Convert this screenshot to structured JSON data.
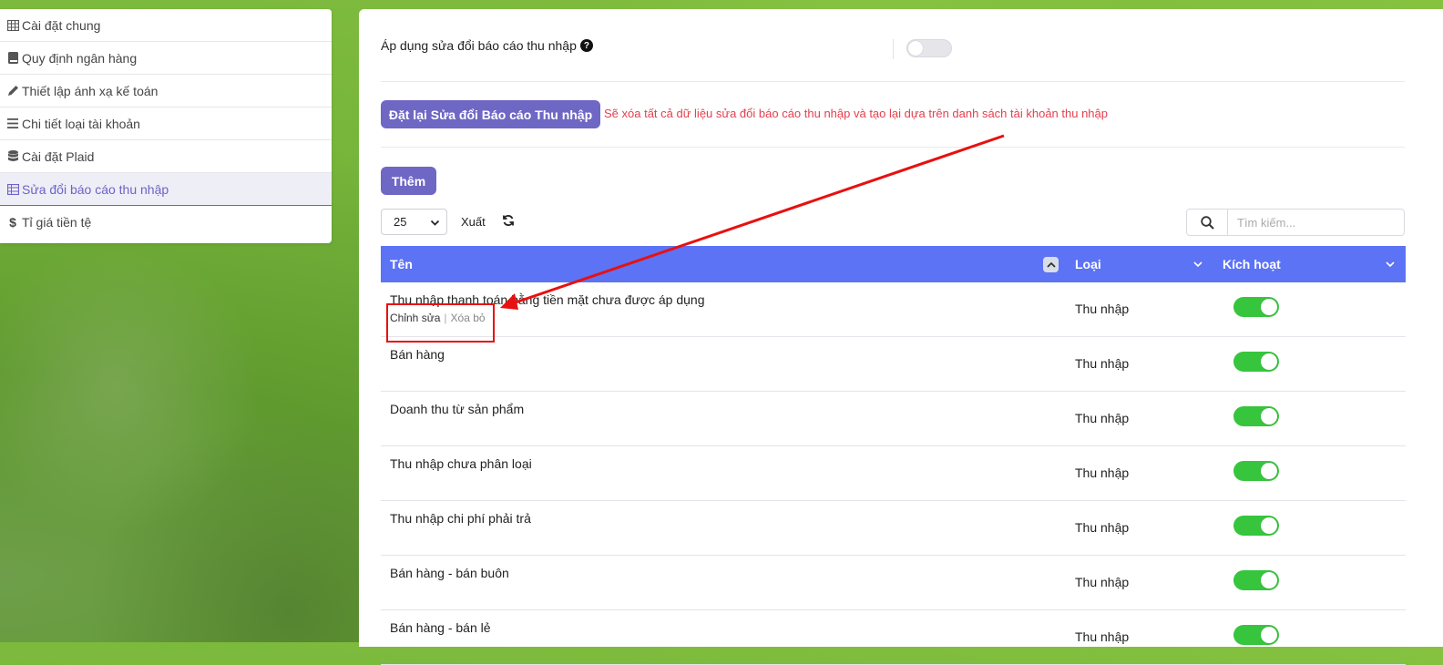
{
  "sidebar": {
    "items": [
      {
        "label": "Cài đặt chung",
        "icon": "table-icon",
        "active": false
      },
      {
        "label": "Quy định ngân hàng",
        "icon": "book-icon",
        "active": false
      },
      {
        "label": "Thiết lập ánh xạ kế toán",
        "icon": "pencil-icon",
        "active": false
      },
      {
        "label": "Chi tiết loại tài khoản",
        "icon": "list-icon",
        "active": false
      },
      {
        "label": "Cài đặt Plaid",
        "icon": "database-icon",
        "active": false
      },
      {
        "label": "Sửa đổi báo cáo thu nhập",
        "icon": "table-icon",
        "active": true
      },
      {
        "label": "Tỉ giá tiền tệ",
        "icon": "dollar-icon",
        "active": false
      }
    ]
  },
  "settings": {
    "apply_label": "Áp dụng sửa đổi báo cáo thu nhập",
    "apply_help_icon": "question-circle-icon",
    "apply_enabled": false
  },
  "reset": {
    "button_label": "Đặt lại Sửa đổi Báo cáo Thu nhập",
    "warning": "Sẽ xóa tất cả dữ liệu sửa đổi báo cáo thu nhập và tạo lại dựa trên danh sách tài khoản thu nhập"
  },
  "toolbar": {
    "add_label": "Thêm",
    "page_size": "25",
    "export_label": "Xuất",
    "search_placeholder": "Tìm kiếm..."
  },
  "table": {
    "headers": {
      "name": "Tên",
      "type": "Loại",
      "active": "Kích hoạt"
    },
    "row_actions": {
      "edit": "Chỉnh sửa",
      "separator": "|",
      "delete": "Xóa bỏ"
    },
    "rows": [
      {
        "name": "Thu nhập thanh toán bằng tiền mặt chưa được áp dụng",
        "type": "Thu nhập",
        "active": true
      },
      {
        "name": "Bán hàng",
        "type": "Thu nhập",
        "active": true
      },
      {
        "name": "Doanh thu từ sản phẩm",
        "type": "Thu nhập",
        "active": true
      },
      {
        "name": "Thu nhập chưa phân loại",
        "type": "Thu nhập",
        "active": true
      },
      {
        "name": "Thu nhập chi phí phải trả",
        "type": "Thu nhập",
        "active": true
      },
      {
        "name": "Bán hàng - bán buôn",
        "type": "Thu nhập",
        "active": true
      },
      {
        "name": "Bán hàng - bán lẻ",
        "type": "Thu nhập",
        "active": true
      }
    ]
  },
  "colors": {
    "accent": "#6f67c4",
    "table_header": "#5c73f5",
    "toggle_on": "#36c53d",
    "warning": "#e5404e",
    "annotation": "#e81010"
  }
}
